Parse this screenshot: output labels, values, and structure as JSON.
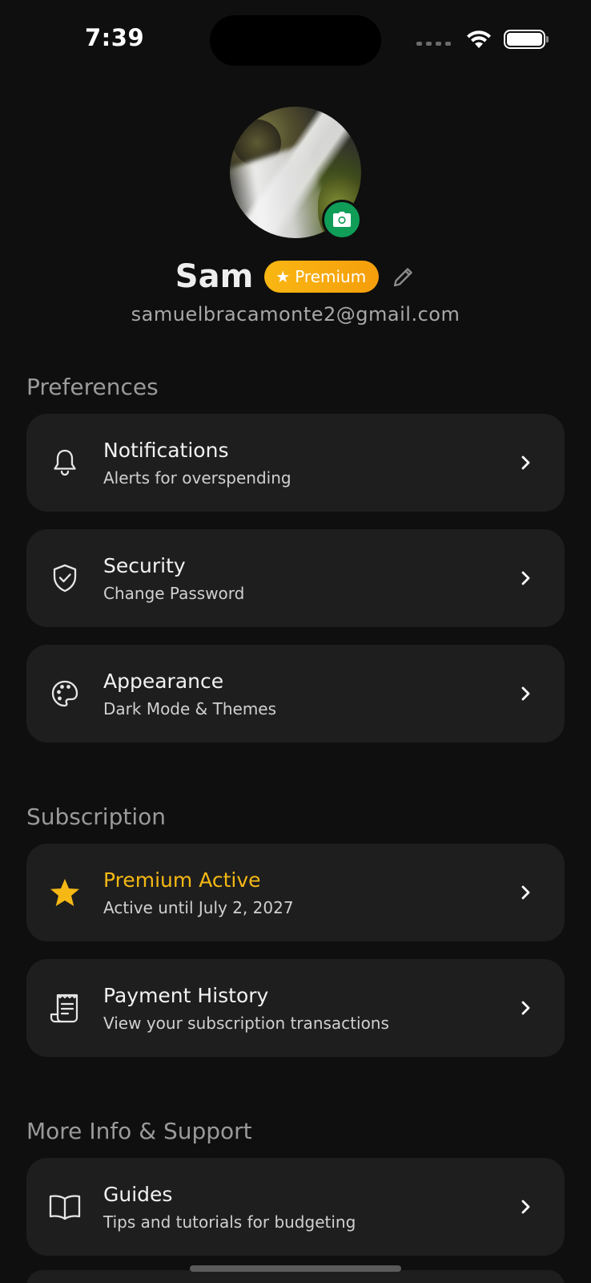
{
  "status_bar": {
    "time": "7:39"
  },
  "profile": {
    "name": "Sam",
    "badge_label": "Premium",
    "email": "samuelbracamonte2@gmail.com"
  },
  "sections": {
    "preferences": {
      "title": "Preferences",
      "items": [
        {
          "title": "Notifications",
          "subtitle": "Alerts for overspending",
          "icon": "bell-icon"
        },
        {
          "title": "Security",
          "subtitle": "Change Password",
          "icon": "shield-check-icon"
        },
        {
          "title": "Appearance",
          "subtitle": "Dark Mode & Themes",
          "icon": "palette-icon"
        }
      ]
    },
    "subscription": {
      "title": "Subscription",
      "items": [
        {
          "title": "Premium Active",
          "subtitle": "Active until July 2, 2027",
          "icon": "star-icon"
        },
        {
          "title": "Payment History",
          "subtitle": "View your subscription transactions",
          "icon": "receipt-icon"
        }
      ]
    },
    "support": {
      "title": "More Info & Support",
      "items": [
        {
          "title": "Guides",
          "subtitle": "Tips and tutorials for budgeting",
          "icon": "book-icon"
        }
      ]
    }
  },
  "colors": {
    "background": "#0f0f0f",
    "card": "#1e1e1e",
    "accent_gold": "#f5b814",
    "camera_green": "#0f9d58"
  }
}
